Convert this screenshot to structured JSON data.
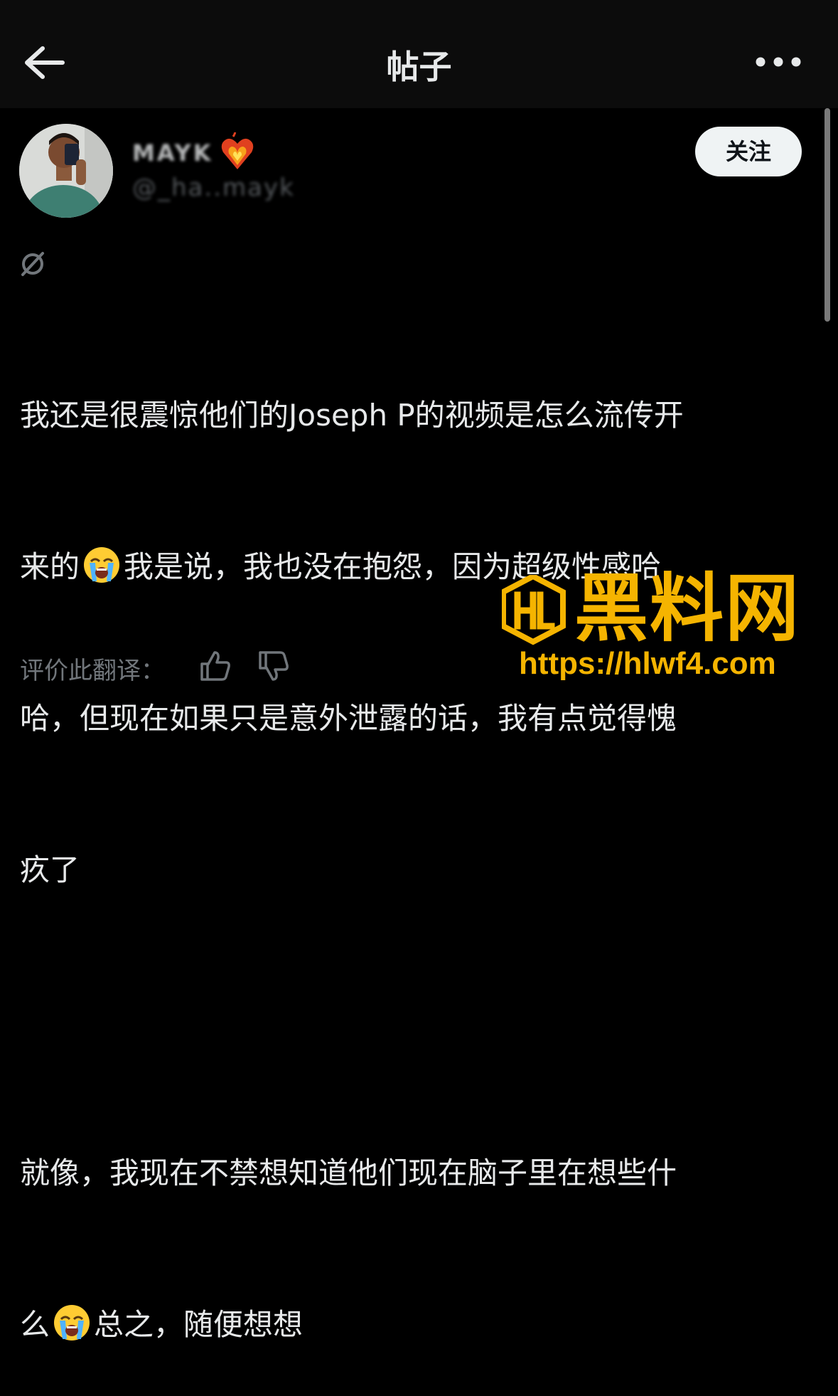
{
  "header": {
    "title": "帖子",
    "back_icon": "arrow-left-icon",
    "more_icon": "more-horizontal-icon"
  },
  "author": {
    "display_name": "MAYK",
    "handle": "@_ha..mayk",
    "badge_emoji": "fire-heart-emoji",
    "follow_label": "关注"
  },
  "post": {
    "translate_icon": "translate-icon",
    "lines": [
      "我还是很震惊他们的Joseph P的视频是怎么流传开",
      [
        "来的",
        "我是说，我也没在抱怨，因为超级性感哈"
      ],
      "哈，但现在如果只是意外泄露的话，我有点觉得愧",
      "疚了",
      "",
      "就像，我现在不禁想知道他们现在脑子里在想些什",
      [
        "么",
        "总之，随便想想"
      ]
    ],
    "emoji_name": "loudly-crying-face-emoji"
  },
  "rating": {
    "label": "评价此翻译：",
    "up_icon": "thumbs-up-icon",
    "down_icon": "thumbs-down-icon"
  },
  "watermark": {
    "title": "黑料网",
    "domain": "https://hlwf4.com",
    "logo_text": "HL",
    "color": "#f5b400"
  },
  "colors": {
    "background": "#000000",
    "topbar": "#0c0c0c",
    "text": "#e7e9ea",
    "muted": "#71767b",
    "follow_bg": "#eff3f4",
    "accent": "#f5b400"
  }
}
